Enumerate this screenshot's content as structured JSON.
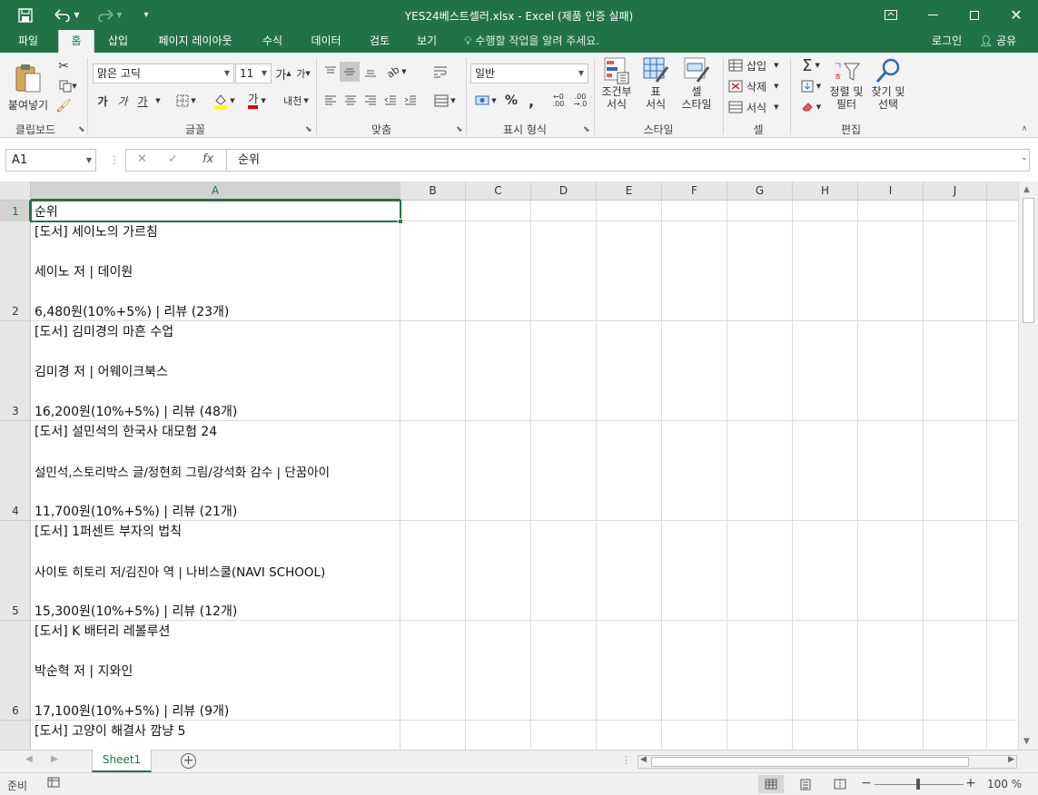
{
  "titlebar": {
    "title": "YES24베스트셀러.xlsx - Excel (제품 인증 실패)",
    "save_icon": "save-icon",
    "undo_icon": "undo-icon",
    "redo_icon": "redo-icon",
    "customize_icon": "customize-qat-icon",
    "ribbon_options_icon": "ribbon-display-icon",
    "minimize_icon": "minimize-icon",
    "maximize_icon": "maximize-icon",
    "close_icon": "close-icon"
  },
  "tabs": {
    "items": [
      "파일",
      "홈",
      "삽입",
      "페이지 레이아웃",
      "수식",
      "데이터",
      "검토",
      "보기"
    ],
    "active": "홈",
    "tell_me": "수행할 작업을 알려 주세요.",
    "login": "로그인",
    "share": "공유"
  },
  "ribbon": {
    "clipboard": {
      "label": "클립보드",
      "paste": "붙여넣기"
    },
    "font": {
      "label": "글꼴",
      "font_name": "맑은 고딕",
      "font_size": "11",
      "bold": "가",
      "italic": "가",
      "underline": "가",
      "font_color_glyph": "가",
      "phonetic": "내천"
    },
    "alignment": {
      "label": "맞춤"
    },
    "number": {
      "label": "표시 형식",
      "format": "일반",
      "percent": "%",
      "comma": ","
    },
    "styles": {
      "label": "스타일",
      "conditional": [
        "조건부",
        "서식"
      ],
      "table": [
        "표",
        "서식"
      ],
      "cell_style": [
        "셀",
        "스타일"
      ]
    },
    "cells": {
      "label": "셀",
      "insert": "삽입",
      "delete": "삭제",
      "format": "서식"
    },
    "editing": {
      "label": "편집",
      "sum": "Σ",
      "sort_filter": [
        "정렬 및",
        "필터"
      ],
      "find_select": [
        "찾기 및",
        "선택"
      ]
    }
  },
  "formula_bar": {
    "name_box": "A1",
    "fx": "fx",
    "content": "순위"
  },
  "grid": {
    "columns": [
      "A",
      "B",
      "C",
      "D",
      "E",
      "F",
      "G",
      "H",
      "I",
      "J"
    ],
    "rows": [
      {
        "num": "1",
        "lines": [
          "순위"
        ]
      },
      {
        "num": "2",
        "lines": [
          "[도서] 세이노의 가르침",
          "",
          "세이노 저 | 데이원",
          "",
          "6,480원(10%+5%) | 리뷰 (23개)"
        ]
      },
      {
        "num": "3",
        "lines": [
          "[도서] 김미경의 마흔 수업",
          "",
          "김미경 저 | 어웨이크북스",
          "",
          "16,200원(10%+5%) | 리뷰 (48개)"
        ]
      },
      {
        "num": "4",
        "lines": [
          "[도서] 설민석의 한국사 대모험 24",
          "",
          "설민석,스토리박스 글/정현희 그림/강석화 감수 | 단꿈아이",
          "",
          "11,700원(10%+5%) | 리뷰 (21개)"
        ]
      },
      {
        "num": "5",
        "lines": [
          "[도서] 1퍼센트 부자의 법칙",
          "",
          "사이토 히토리 저/김진아 역 | 나비스쿨(NAVI SCHOOL)",
          "",
          "15,300원(10%+5%) | 리뷰 (12개)"
        ]
      },
      {
        "num": "6",
        "lines": [
          "[도서] K 배터리 레볼루션",
          "",
          "박순혁 저 | 지와인",
          "",
          "17,100원(10%+5%) | 리뷰 (9개)"
        ]
      },
      {
        "num": "",
        "lines": [
          "[도서] 고양이 해결사 깜냥 5"
        ]
      }
    ]
  },
  "sheets": {
    "tabs": [
      "Sheet1"
    ],
    "active": "Sheet1",
    "add": "+"
  },
  "status": {
    "ready": "준비",
    "zoom": "100 %",
    "zoom_out": "−",
    "zoom_in": "+"
  },
  "colors": {
    "accent": "#217346",
    "ribbon_bg": "#f3f3f3",
    "header_bg": "#e6e6e6",
    "gridline": "#dadada"
  }
}
